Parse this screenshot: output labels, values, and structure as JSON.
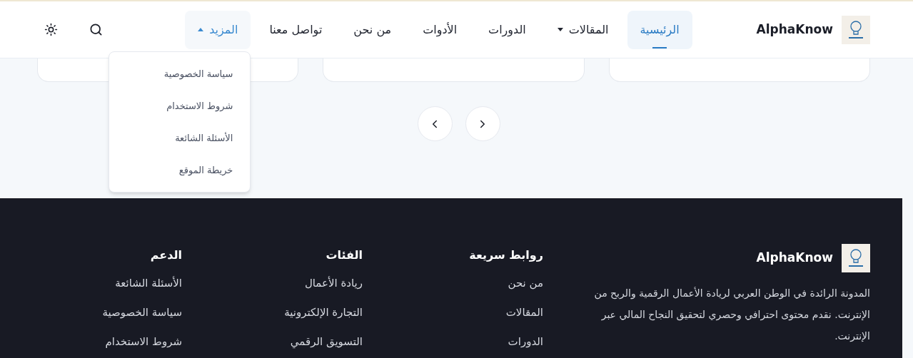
{
  "header": {
    "brand": "AlphaKnow",
    "nav": [
      {
        "label": "الرئيسية",
        "kind": "link",
        "selected": true
      },
      {
        "label": "المقالات",
        "kind": "dropdown",
        "selected": false,
        "expanded": false
      },
      {
        "label": "الدورات",
        "kind": "link",
        "selected": false
      },
      {
        "label": "الأدوات",
        "kind": "link",
        "selected": false
      },
      {
        "label": "من نحن",
        "kind": "link",
        "selected": false
      },
      {
        "label": "تواصل معنا",
        "kind": "link",
        "selected": false
      },
      {
        "label": "المزيد",
        "kind": "dropdown",
        "selected": false,
        "expanded": true,
        "children": [
          "سياسة الخصوصية",
          "شروط الاستخدام",
          "الأسئلة الشائعة",
          "خريطة الموقع"
        ]
      }
    ]
  },
  "footer": {
    "brand": "AlphaKnow",
    "description": "المدونة الرائدة في الوطن العربي لريادة الأعمال الرقمية والربح من الإنترنت. نقدم محتوى احترافي وحصري لتحقيق النجاح المالي عبر الإنترنت.",
    "columns": [
      {
        "title": "روابط سريعة",
        "links": [
          "من نحن",
          "المقالات",
          "الدورات"
        ]
      },
      {
        "title": "الفئات",
        "links": [
          "ريادة الأعمال",
          "التجارة الإلكترونية",
          "التسويق الرقمي"
        ]
      },
      {
        "title": "الدعم",
        "links": [
          "الأسئلة الشائعة",
          "سياسة الخصوصية",
          "شروط الاستخدام"
        ]
      }
    ]
  }
}
